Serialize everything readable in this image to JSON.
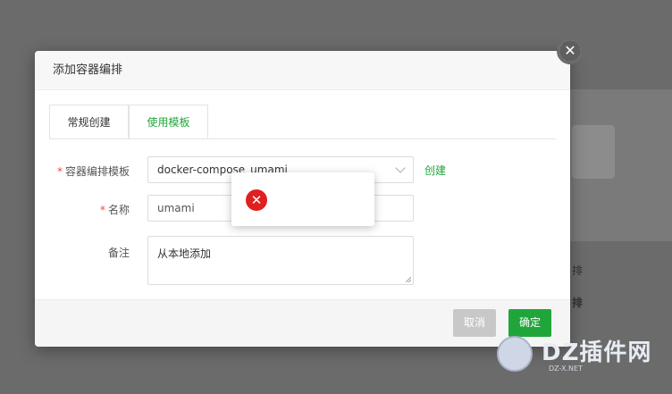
{
  "background": {
    "text1": "排",
    "text2": "排"
  },
  "dialog": {
    "title": "添加容器编排",
    "tabs": [
      {
        "label": "常规创建"
      },
      {
        "label": "使用模板"
      }
    ],
    "form": {
      "template_label": "容器编排模板",
      "template_required": "*",
      "template_value": "docker-compose_umami",
      "create_link": "创建",
      "name_label": "名称",
      "name_required": "*",
      "name_value": "umami",
      "remark_label": "备注",
      "remark_value": "从本地添加"
    },
    "footer": {
      "cancel_label": "取消",
      "ok_label": "确定"
    }
  },
  "error_popup": {
    "icon": "error-icon"
  },
  "watermark": {
    "text": "DZ插件网",
    "sub": "DZ-X.NET"
  },
  "colors": {
    "accent": "#20a53a",
    "error": "#e02020",
    "required": "#ef4444"
  }
}
